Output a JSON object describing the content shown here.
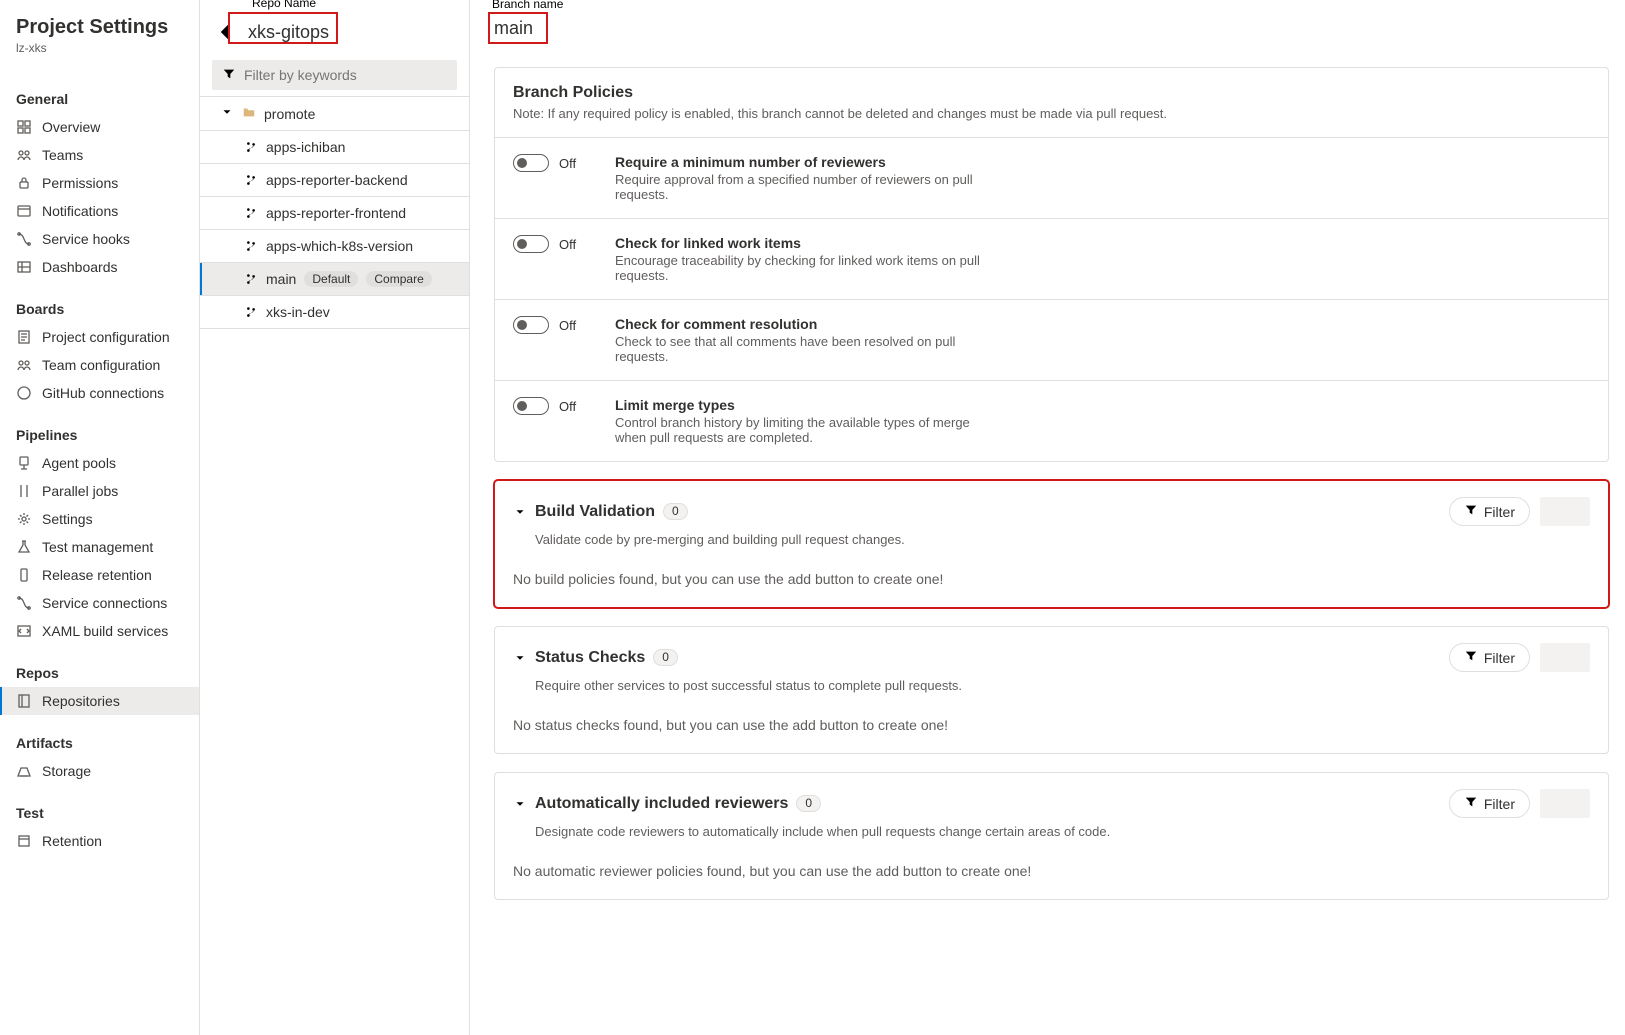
{
  "project_settings": {
    "title": "Project Settings",
    "subtitle": "lz-xks"
  },
  "nav": {
    "groups": [
      {
        "title": "General",
        "items": [
          {
            "icon": "grid",
            "label": "Overview"
          },
          {
            "icon": "team",
            "label": "Teams"
          },
          {
            "icon": "lock",
            "label": "Permissions"
          },
          {
            "icon": "bell",
            "label": "Notifications"
          },
          {
            "icon": "hook",
            "label": "Service hooks"
          },
          {
            "icon": "dash",
            "label": "Dashboards"
          }
        ]
      },
      {
        "title": "Boards",
        "items": [
          {
            "icon": "page",
            "label": "Project configuration"
          },
          {
            "icon": "team",
            "label": "Team configuration"
          },
          {
            "icon": "github",
            "label": "GitHub connections"
          }
        ]
      },
      {
        "title": "Pipelines",
        "items": [
          {
            "icon": "agent",
            "label": "Agent pools"
          },
          {
            "icon": "parallel",
            "label": "Parallel jobs"
          },
          {
            "icon": "gear",
            "label": "Settings"
          },
          {
            "icon": "flask",
            "label": "Test management"
          },
          {
            "icon": "phone",
            "label": "Release retention"
          },
          {
            "icon": "hook",
            "label": "Service connections"
          },
          {
            "icon": "xaml",
            "label": "XAML build services"
          }
        ]
      },
      {
        "title": "Repos",
        "items": [
          {
            "icon": "repo",
            "label": "Repositories",
            "selected": true
          }
        ]
      },
      {
        "title": "Artifacts",
        "items": [
          {
            "icon": "storage",
            "label": "Storage"
          }
        ]
      },
      {
        "title": "Test",
        "items": [
          {
            "icon": "retention",
            "label": "Retention"
          }
        ]
      }
    ]
  },
  "repo": {
    "name": "xks-gitops",
    "filter_placeholder": "Filter by keywords",
    "folder": "promote",
    "branches": [
      {
        "name": "apps-ichiban"
      },
      {
        "name": "apps-reporter-backend"
      },
      {
        "name": "apps-reporter-frontend"
      },
      {
        "name": "apps-which-k8s-version"
      },
      {
        "name": "main",
        "default_badge": "Default",
        "compare_badge": "Compare",
        "selected": true
      },
      {
        "name": "xks-in-dev"
      }
    ]
  },
  "branch": {
    "name": "main"
  },
  "branch_policies": {
    "title": "Branch Policies",
    "note": "Note: If any required policy is enabled, this branch cannot be deleted and changes must be made via pull request.",
    "policies": [
      {
        "state_label": "Off",
        "title": "Require a minimum number of reviewers",
        "desc": "Require approval from a specified number of reviewers on pull requests."
      },
      {
        "state_label": "Off",
        "title": "Check for linked work items",
        "desc": "Encourage traceability by checking for linked work items on pull requests."
      },
      {
        "state_label": "Off",
        "title": "Check for comment resolution",
        "desc": "Check to see that all comments have been resolved on pull requests."
      },
      {
        "state_label": "Off",
        "title": "Limit merge types",
        "desc": "Control branch history by limiting the available types of merge when pull requests are completed."
      }
    ]
  },
  "build_validation": {
    "title": "Build Validation",
    "count": "0",
    "desc": "Validate code by pre-merging and building pull request changes.",
    "empty": "No build policies found, but you can use the add button to create one!",
    "filter_label": "Filter"
  },
  "status_checks": {
    "title": "Status Checks",
    "count": "0",
    "desc": "Require other services to post successful status to complete pull requests.",
    "empty": "No status checks found, but you can use the add button to create one!",
    "filter_label": "Filter"
  },
  "auto_reviewers": {
    "title": "Automatically included reviewers",
    "count": "0",
    "desc": "Designate code reviewers to automatically include when pull requests change certain areas of code.",
    "empty": "No automatic reviewer policies found, but you can use the add button to create one!",
    "filter_label": "Filter"
  },
  "annotations": {
    "repo_label": "Repo Name",
    "branch_label": "Branch name"
  }
}
